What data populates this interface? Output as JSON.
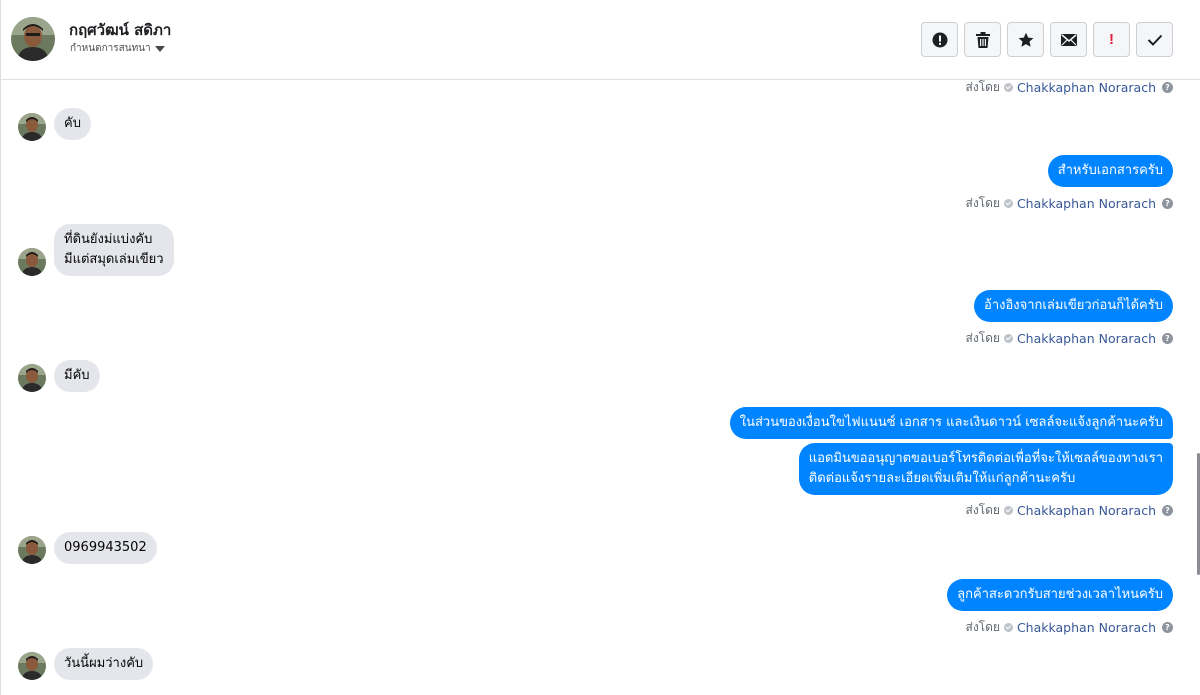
{
  "header": {
    "contact_name": "กฤศวัฒน์ สดิภา",
    "assign_label": "กำหนดการสนทนา",
    "actions": {
      "alert_icon": "exclamation-circle-icon",
      "trash_icon": "trash-icon",
      "star_icon": "star-icon",
      "mail_icon": "envelope-icon",
      "important_label": "!",
      "done_icon": "checkmark-icon"
    }
  },
  "sent_by": {
    "prefix": "ส่งโดย",
    "agent": "Chakkaphan Norarach",
    "help": "?"
  },
  "messages": [
    {
      "direction": "in",
      "text": "คับ"
    },
    {
      "direction": "out",
      "text": "สำหรับเอกสารครับ"
    },
    {
      "direction": "in",
      "lines": [
        "ที่ดินยังม่แบ่งคับ",
        "มีแต่สมุดเล่มเขียว"
      ]
    },
    {
      "direction": "out",
      "text": "อ้างอิงจากเล่มเขียวก่อนก็ได้ครับ"
    },
    {
      "direction": "in",
      "text": "มีคับ"
    },
    {
      "direction": "out",
      "text": "ในส่วนของเงื่อนใขไฟแนนซ์ เอกสาร และเงินดาวน์ เซลล์จะแจ้งลูกค้านะครับ"
    },
    {
      "direction": "out",
      "lines": [
        "แอดมินขออนุญาตขอเบอร์โทรติดต่อเพื่อที่จะให้เซลล์ของทางเรา",
        "ติดต่อแจ้งรายละเอียดเพิ่มเติมให้แก่ลูกค้านะครับ"
      ]
    },
    {
      "direction": "in",
      "text": "0969943502"
    },
    {
      "direction": "out",
      "text": "ลูกค้าสะดวกรับสายช่วงเวลาไหนครับ"
    },
    {
      "direction": "in",
      "text": "วันนี้ผมว่างคับ"
    }
  ],
  "colors": {
    "outgoing_bubble": "#0084ff",
    "incoming_bubble": "#e4e6eb",
    "agent_link": "#385898"
  }
}
